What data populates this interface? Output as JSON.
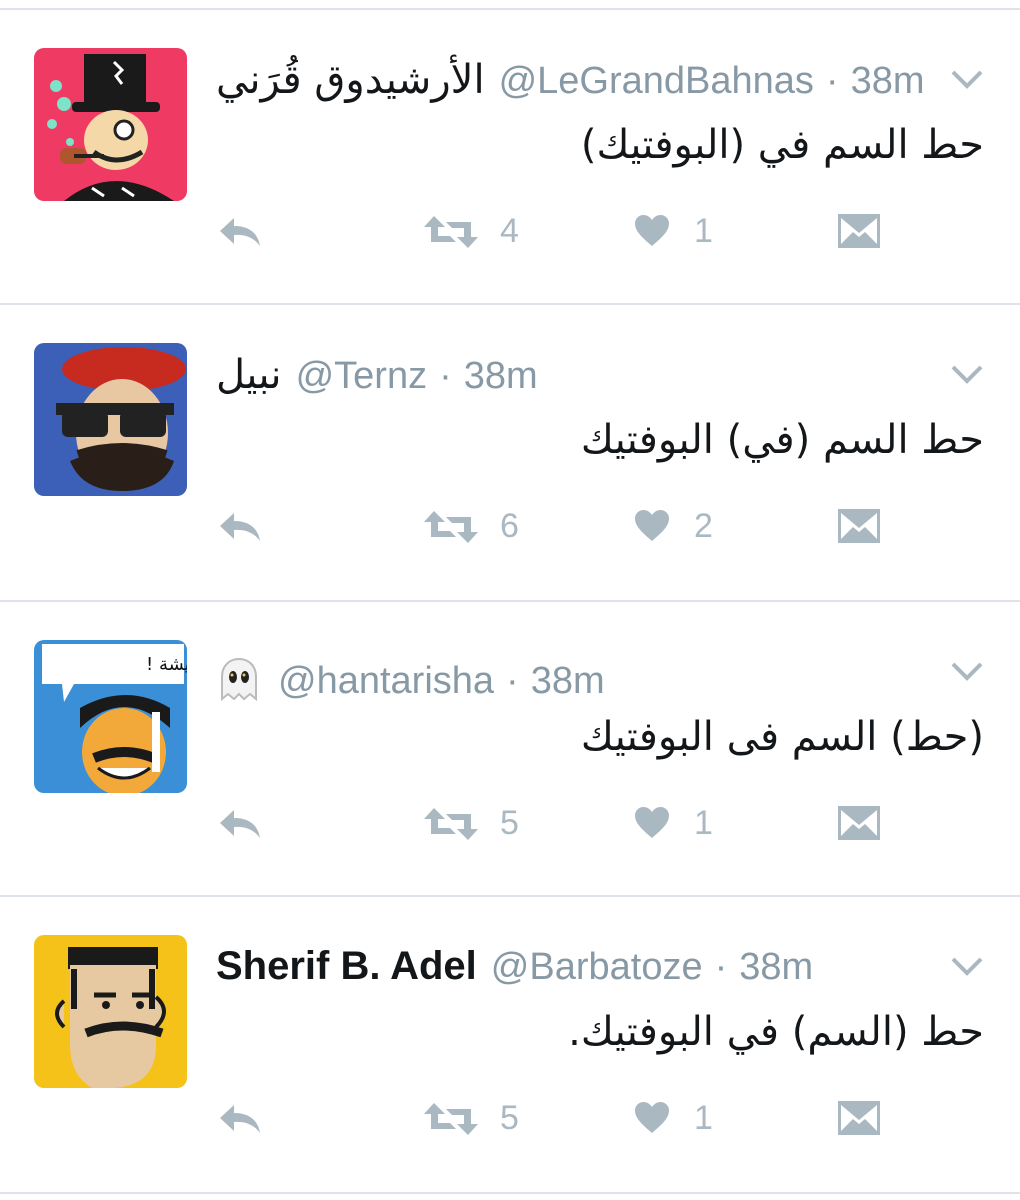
{
  "tweets": [
    {
      "name": "الأرشيدوق قُرَني",
      "handle": "@LeGrandBahnas",
      "separator": "·",
      "time": "38m",
      "text": "حط السم في (البوفتيك)",
      "retweets": "4",
      "likes": "1",
      "avatar": "top-hat-pipe-cartoon"
    },
    {
      "name": "نبيل",
      "handle": "@Ternz",
      "separator": "·",
      "time": "38m",
      "text": "حط السم (في) البوفتيك",
      "retweets": "6",
      "likes": "2",
      "avatar": "beret-sunglasses-cartoon"
    },
    {
      "name": "",
      "handle": "@hantarisha",
      "separator": "·",
      "time": "38m",
      "text": "(حط) السم فى البوفتيك",
      "retweets": "5",
      "likes": "1",
      "avatar": "speech-bubble-cartoon",
      "avatar_speech": "حنتريشة !",
      "name_icon": "ghost-emoji-icon"
    },
    {
      "name": "Sherif B. Adel",
      "handle": "@Barbatoze",
      "separator": "·",
      "time": "38m",
      "text": "حط (السم) في البوفتيك.",
      "retweets": "5",
      "likes": "1",
      "avatar": "flat-top-mustache-cartoon"
    }
  ],
  "colors": {
    "action_icon": "#aab8c2",
    "handle": "#8899a6",
    "divider": "#dde3e8"
  },
  "icons": [
    "reply-icon",
    "retweet-icon",
    "like-icon",
    "dm-icon",
    "caret-down-icon"
  ]
}
